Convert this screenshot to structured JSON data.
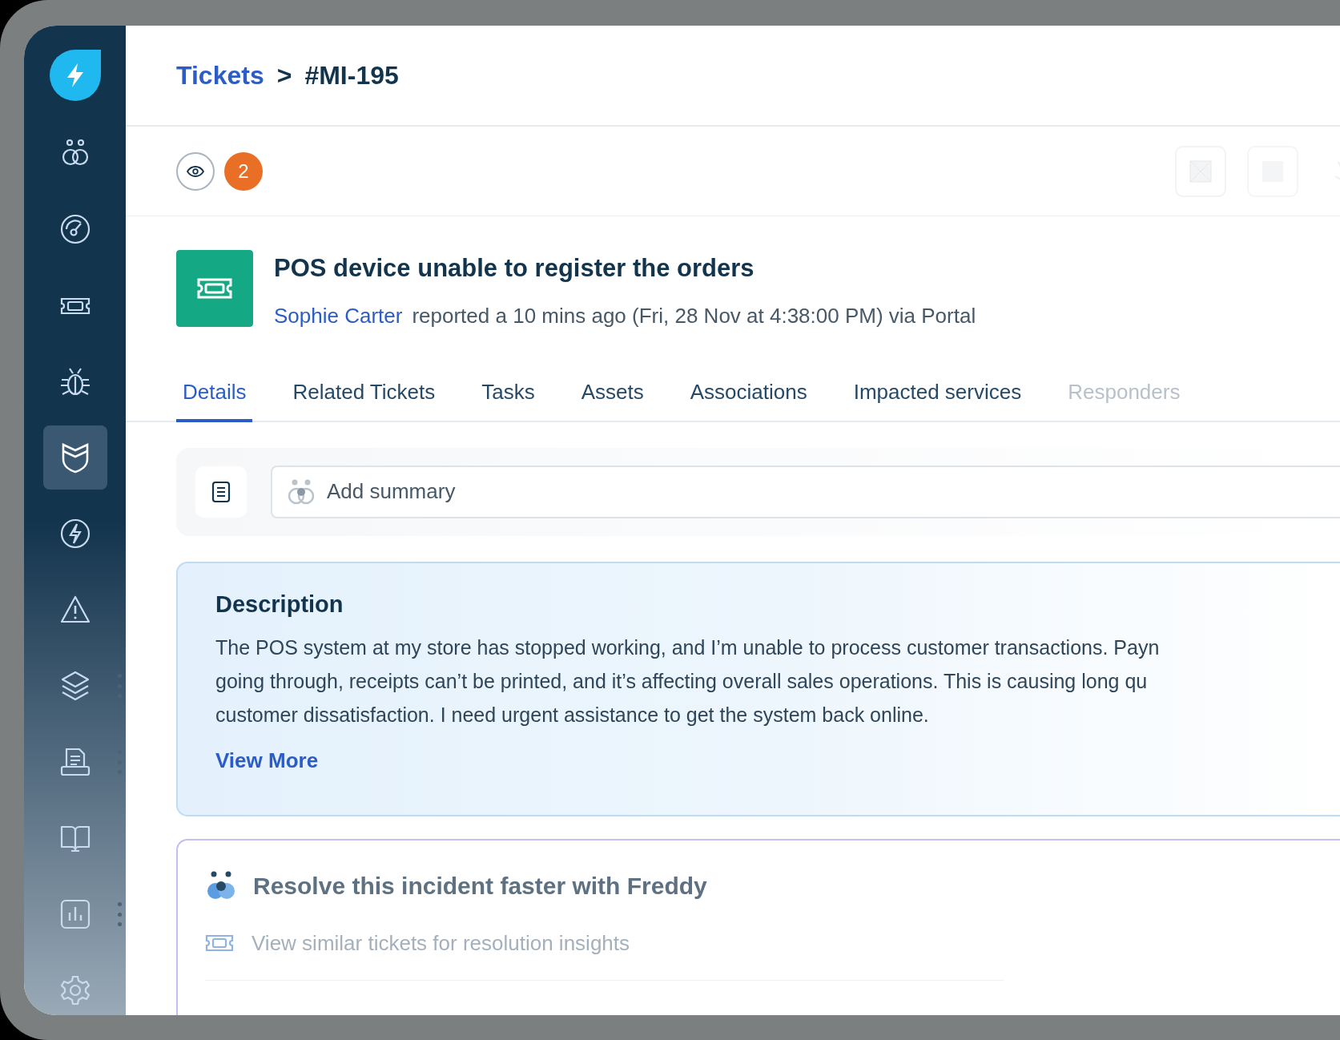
{
  "sidebar": {
    "items": [
      {
        "kind": "logo",
        "selected": false,
        "has_menu": false
      },
      {
        "kind": "freddy",
        "selected": false,
        "has_menu": false
      },
      {
        "kind": "gauge",
        "selected": false,
        "has_menu": false
      },
      {
        "kind": "ticket",
        "selected": false,
        "has_menu": false
      },
      {
        "kind": "bug",
        "selected": false,
        "has_menu": false
      },
      {
        "kind": "shield",
        "selected": true,
        "has_menu": false
      },
      {
        "kind": "bolt",
        "selected": false,
        "has_menu": false
      },
      {
        "kind": "warning",
        "selected": false,
        "has_menu": false
      },
      {
        "kind": "layers",
        "selected": false,
        "has_menu": true
      },
      {
        "kind": "document",
        "selected": false,
        "has_menu": true
      },
      {
        "kind": "book",
        "selected": false,
        "has_menu": false
      },
      {
        "kind": "chart",
        "selected": false,
        "has_menu": true
      },
      {
        "kind": "gear",
        "selected": false,
        "has_menu": false
      }
    ]
  },
  "breadcrumb": {
    "parent": "Tickets",
    "separator": ">",
    "current": "#MI-195"
  },
  "toolbar": {
    "watchers_count": "2"
  },
  "ticket": {
    "title": "POS device unable to register the orders",
    "requester": "Sophie Carter",
    "meta": "reported a 10 mins ago (Fri, 28 Nov at 4:38:00 PM) via Portal"
  },
  "tabs": [
    {
      "label": "Details",
      "selected": true,
      "dimmed": false
    },
    {
      "label": "Related Tickets",
      "selected": false,
      "dimmed": false
    },
    {
      "label": "Tasks",
      "selected": false,
      "dimmed": false
    },
    {
      "label": "Assets",
      "selected": false,
      "dimmed": false
    },
    {
      "label": "Associations",
      "selected": false,
      "dimmed": false
    },
    {
      "label": "Impacted services",
      "selected": false,
      "dimmed": false
    },
    {
      "label": "Responders",
      "selected": false,
      "dimmed": true
    }
  ],
  "summary": {
    "placeholder": "Add summary"
  },
  "description": {
    "title": "Description",
    "lines": [
      "The POS system at my store has stopped working, and I’m unable to process customer transactions. Payn",
      "going through, receipts can’t be printed, and it’s affecting overall sales operations. This is causing long qu",
      "customer dissatisfaction. I need urgent assistance to get the system back online."
    ],
    "link": "View More"
  },
  "freddy": {
    "title": "Resolve this incident faster with Freddy",
    "items": [
      {
        "label": "View similar tickets for resolution insights"
      }
    ]
  }
}
